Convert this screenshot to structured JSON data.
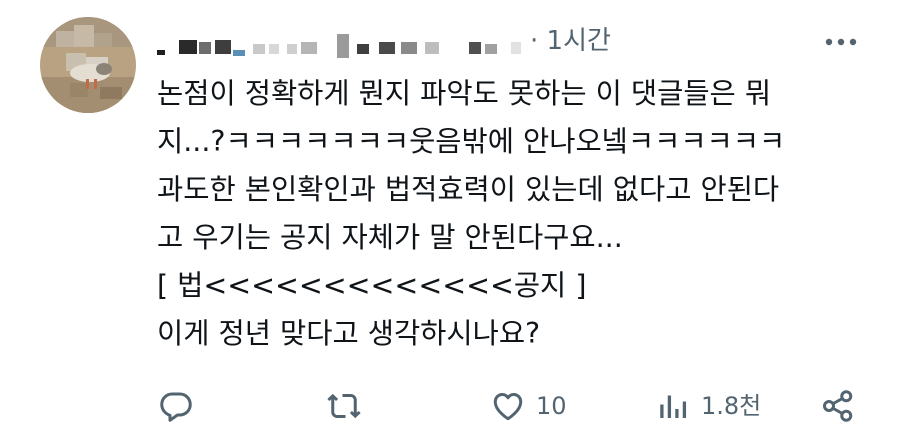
{
  "header": {
    "separator": "·",
    "time": "1시간"
  },
  "body": {
    "lines": [
      "논점이 정확하게 뭔지 파악도 못하는 이 댓글들은 뭐",
      "지...?ㅋㅋㅋㅋㅋㅋㅋ웃음밖에 안나오넼ㅋㅋㅋㅋㅋㅋ",
      "과도한 본인확인과 법적효력이 있는데 없다고 안된다",
      "고 우기는 공지 자체가 말 안된다구요...",
      "[ 법<<<<<<<<<<<<<공지 ]",
      "이게 정년 맞다고 생각하시나요?"
    ]
  },
  "actions": {
    "reply_icon": "reply-icon",
    "retweet_icon": "retweet-icon",
    "like_icon": "heart-icon",
    "like_count": "10",
    "views_icon": "views-icon",
    "views_count": "1.8천",
    "share_icon": "share-icon"
  },
  "colors": {
    "text": "#0f1419",
    "secondary": "#536471"
  }
}
